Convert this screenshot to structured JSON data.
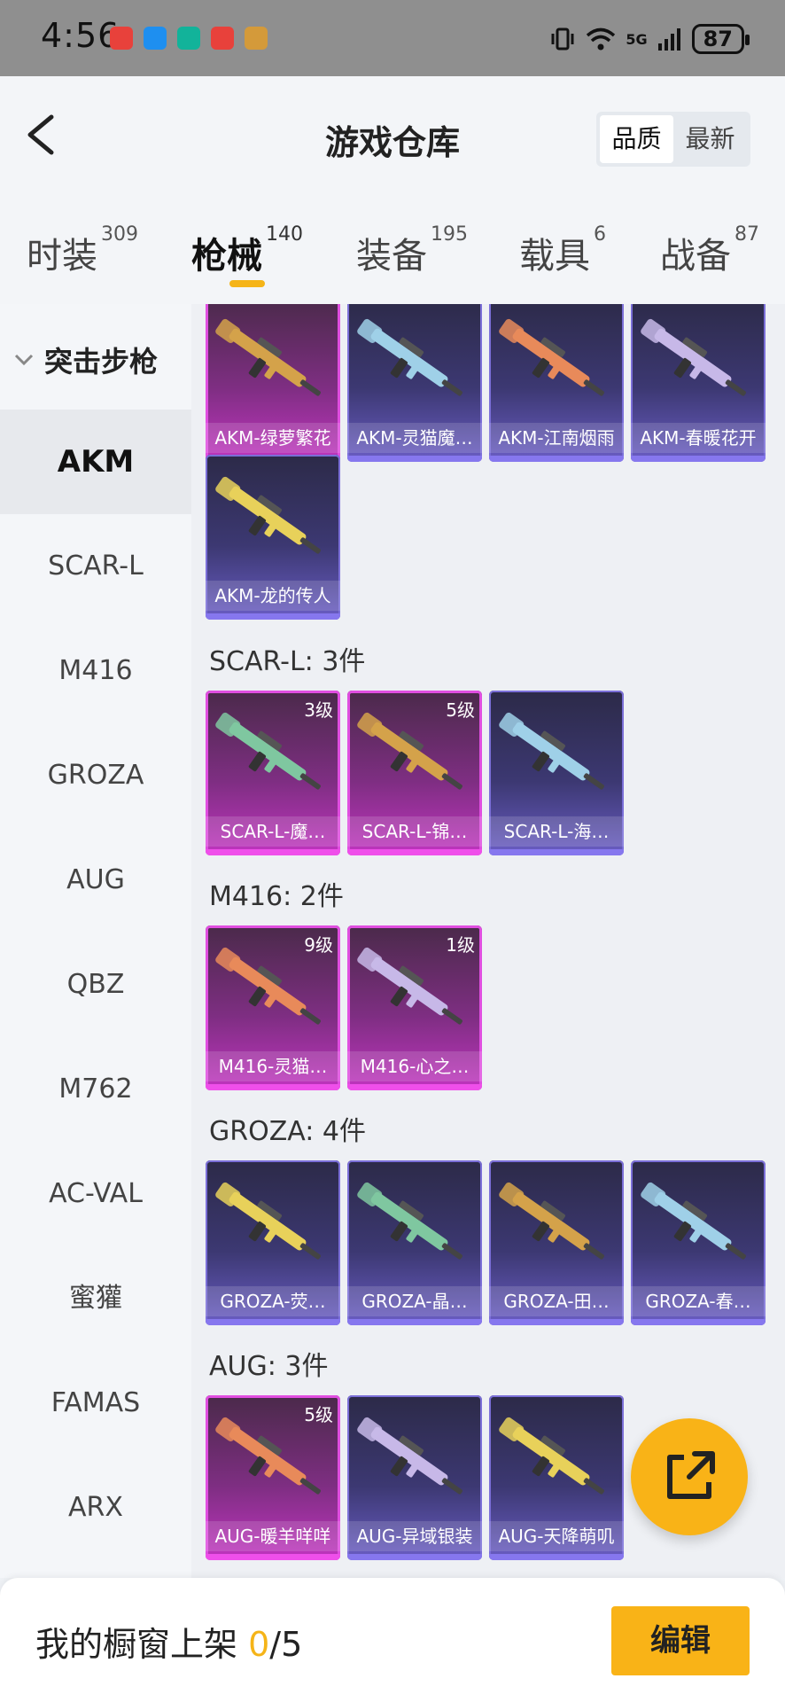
{
  "status_bar": {
    "time": "4:56",
    "network": "5G",
    "battery": "87"
  },
  "header": {
    "title": "游戏仓库",
    "sort_options": [
      "品质",
      "最新"
    ],
    "sort_active": "品质"
  },
  "tabs": [
    {
      "label": "时装",
      "count": "309"
    },
    {
      "label": "枪械",
      "count": "140",
      "active": true
    },
    {
      "label": "装备",
      "count": "195"
    },
    {
      "label": "载具",
      "count": "6"
    },
    {
      "label": "战备",
      "count": "87"
    }
  ],
  "sidebar": {
    "category": "突击步枪",
    "items": [
      "AKM",
      "SCAR-L",
      "M416",
      "GROZA",
      "AUG",
      "QBZ",
      "M762",
      "AC-VAL",
      "蜜獾",
      "FAMAS",
      "ARX"
    ],
    "active": "AKM"
  },
  "sections": [
    {
      "title": "",
      "cards": [
        {
          "name": "AKM-绿萝繁花",
          "level": "",
          "rarity": "pink"
        },
        {
          "name": "AKM-灵猫魔…",
          "level": "",
          "rarity": "purple"
        },
        {
          "name": "AKM-江南烟雨",
          "level": "",
          "rarity": "purple"
        },
        {
          "name": "AKM-春暖花开",
          "level": "",
          "rarity": "purple"
        },
        {
          "name": "AKM-龙的传人",
          "level": "",
          "rarity": "purple"
        }
      ]
    },
    {
      "title": "SCAR-L: 3件",
      "cards": [
        {
          "name": "SCAR-L-魔…",
          "level": "3级",
          "rarity": "pink"
        },
        {
          "name": "SCAR-L-锦…",
          "level": "5级",
          "rarity": "pink"
        },
        {
          "name": "SCAR-L-海…",
          "level": "",
          "rarity": "purple"
        }
      ]
    },
    {
      "title": "M416: 2件",
      "cards": [
        {
          "name": "M416-灵猫…",
          "level": "9级",
          "rarity": "pink"
        },
        {
          "name": "M416-心之…",
          "level": "1级",
          "rarity": "pink"
        }
      ]
    },
    {
      "title": "GROZA: 4件",
      "cards": [
        {
          "name": "GROZA-荧…",
          "level": "",
          "rarity": "purple"
        },
        {
          "name": "GROZA-晶…",
          "level": "",
          "rarity": "purple"
        },
        {
          "name": "GROZA-田…",
          "level": "",
          "rarity": "purple"
        },
        {
          "name": "GROZA-春…",
          "level": "",
          "rarity": "purple"
        }
      ]
    },
    {
      "title": "AUG: 3件",
      "cards": [
        {
          "name": "AUG-暖羊咩咩",
          "level": "5级",
          "rarity": "pink"
        },
        {
          "name": "AUG-异域银装",
          "level": "",
          "rarity": "purple"
        },
        {
          "name": "AUG-天降萌叽",
          "level": "",
          "rarity": "purple"
        }
      ]
    }
  ],
  "bottom": {
    "label": "我的橱窗上架",
    "count": "0",
    "total": "/5",
    "edit_label": "编辑"
  },
  "colors": {
    "accent": "#f9b317",
    "rarity_pink": "#e04ee0",
    "rarity_purple": "#7b6fd8"
  }
}
